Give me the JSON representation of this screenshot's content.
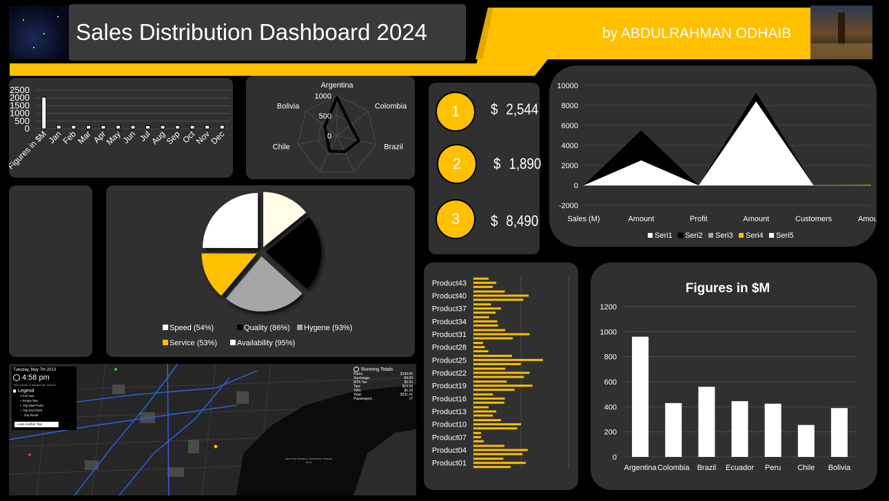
{
  "header": {
    "title": "Sales Distribution Dashboard 2024",
    "author": "by ABDULRAHMAN ODHAIB"
  },
  "colors": {
    "accent": "#ffc000",
    "panel": "#303030",
    "background": "#000000"
  },
  "kpis": [
    {
      "rank": "1",
      "currency": "$",
      "value": "2,544"
    },
    {
      "rank": "2",
      "currency": "$",
      "value": "1,890"
    },
    {
      "rank": "3",
      "currency": "$",
      "value": "8,490"
    }
  ],
  "chart_data": [
    {
      "id": "monthly",
      "type": "bar",
      "categories": [
        "Figures in $M",
        "Jan",
        "Feb",
        "Mar",
        "Apr",
        "May",
        "Jun",
        "Jul",
        "Aug",
        "Sep",
        "Oct",
        "Nov",
        "Dec"
      ],
      "values": [
        2050,
        220,
        215,
        210,
        205,
        215,
        210,
        200,
        210,
        205,
        210,
        215,
        220
      ],
      "yticks": [
        0,
        500,
        1000,
        1500,
        2000,
        2500
      ],
      "ylim": [
        0,
        2500
      ],
      "grid": true
    },
    {
      "id": "radar",
      "type": "radar",
      "categories": [
        "Argentina",
        "Colombia",
        "Brazil",
        "Ecuador",
        "Peru",
        "Chile",
        "Bolivia"
      ],
      "values": [
        960,
        430,
        560,
        445,
        425,
        255,
        390
      ],
      "rticks": [
        0,
        500,
        1000
      ],
      "rlim": [
        0,
        1000
      ]
    },
    {
      "id": "area",
      "type": "area",
      "categories": [
        "Sales (M)",
        "Amount",
        "Profit",
        "Amount",
        "Customers",
        "Amount"
      ],
      "series": [
        {
          "name": "Seri1",
          "color": "#ffffff",
          "values": [
            0,
            2500,
            0,
            8400,
            0,
            0
          ]
        },
        {
          "name": "Seri2",
          "color": "#000000",
          "values": [
            0,
            5500,
            0,
            9300,
            0,
            0
          ]
        },
        {
          "name": "Seri3",
          "color": "#a6a6a6",
          "values": [
            0,
            0,
            0,
            0,
            0,
            0
          ]
        },
        {
          "name": "Seri4",
          "color": "#ffc000",
          "values": [
            0,
            0,
            0,
            0,
            0,
            50
          ]
        },
        {
          "name": "Seri5",
          "color": "#ffffff",
          "values": [
            0,
            0,
            0,
            0,
            0,
            0
          ]
        }
      ],
      "yticks": [
        -2000,
        0,
        2000,
        4000,
        6000,
        8000,
        10000
      ],
      "ylim": [
        -2000,
        10000
      ],
      "grid": true,
      "legend": "bottom"
    },
    {
      "id": "pie",
      "type": "pie",
      "slices": [
        {
          "label": "Speed (54%)",
          "value": 54,
          "color": "#fffde6"
        },
        {
          "label": "Quality (86%)",
          "value": 86,
          "color": "#000000"
        },
        {
          "label": "Hygene (93%)",
          "value": 93,
          "color": "#a6a6a6"
        },
        {
          "label": "Service (53%)",
          "value": 53,
          "color": "#ffc000"
        },
        {
          "label": "Availability (95%)",
          "value": 95,
          "color": "#ffffff"
        }
      ],
      "legend": "bottom"
    },
    {
      "id": "products",
      "type": "bar",
      "orientation": "horizontal",
      "categories": [
        "Product43",
        "Product40",
        "Product37",
        "Product34",
        "Product31",
        "Product28",
        "Product25",
        "Product22",
        "Product19",
        "Product16",
        "Product13",
        "Product10",
        "Product07",
        "Product04",
        "Product01"
      ],
      "values": [
        24,
        58,
        29,
        25,
        59,
        12,
        73,
        59,
        62,
        33,
        24,
        50,
        8,
        57,
        55
      ],
      "xlim": [
        0,
        100
      ],
      "bar_color": "#ffc000"
    },
    {
      "id": "countries",
      "type": "bar",
      "title": "Figures in $M",
      "categories": [
        "Argentina",
        "Colombia",
        "Brazil",
        "Ecuador",
        "Peru",
        "Chile",
        "Bolivia"
      ],
      "values": [
        960,
        430,
        560,
        445,
        425,
        255,
        390
      ],
      "yticks": [
        0,
        200,
        400,
        600,
        800,
        1000,
        1200
      ],
      "ylim": [
        0,
        1200
      ],
      "grid": true
    }
  ],
  "map": {
    "date": "Tuesday, May 7th 2013",
    "time": "4:58 pm",
    "speed_note": "Time Factor: 5 minutes per second",
    "legend_title": "Legend",
    "legend_items": [
      "Full Taxi",
      "Empty Taxi",
      "Trip Start Point",
      "Trip End Point",
      "Trip Route"
    ],
    "load_button": "Load Another Taxi",
    "totals_title": "Running Totals",
    "totals": [
      {
        "label": "Fares:",
        "value": "$199.00"
      },
      {
        "label": "Surcharge:",
        "value": "$4.00"
      },
      {
        "label": "MTA Tax:",
        "value": "$6.50"
      },
      {
        "label": "Tips:",
        "value": "$14.58"
      },
      {
        "label": "Tolls:",
        "value": "$5.33"
      },
      {
        "label": "Total:",
        "value": "$231.41"
      },
      {
        "label": "Passengers:",
        "value": "17"
      }
    ],
    "landmark": "New York Museum Greenwich Seaport Area"
  }
}
